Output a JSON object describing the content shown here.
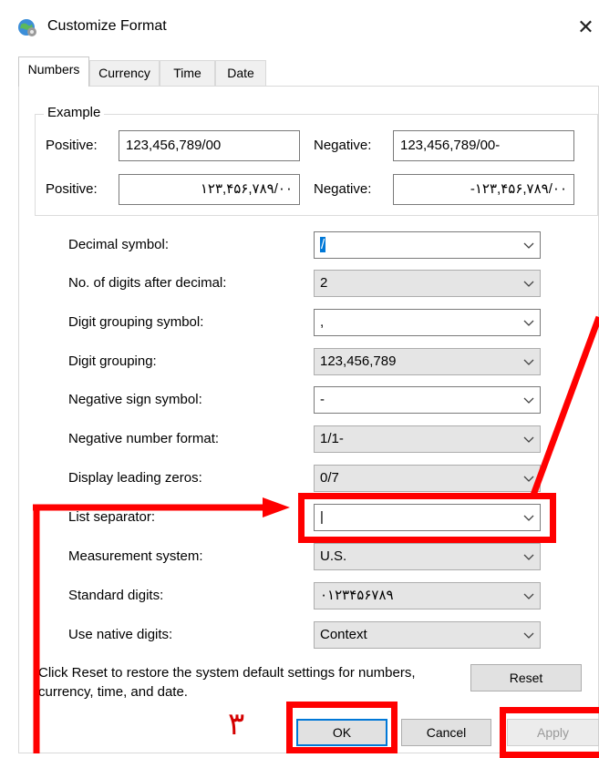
{
  "window": {
    "title": "Customize Format",
    "close_glyph": "✕",
    "icon": "globe-settings-icon"
  },
  "tabs": [
    {
      "label": "Numbers",
      "active": true
    },
    {
      "label": "Currency",
      "active": false
    },
    {
      "label": "Time",
      "active": false
    },
    {
      "label": "Date",
      "active": false
    }
  ],
  "example": {
    "legend": "Example",
    "positive_label": "Positive:",
    "negative_label": "Negative:",
    "positive_latin": "123,456,789/00",
    "negative_latin": "123,456,789/00-",
    "positive_native": "۱۲۳,۴۵۶,۷۸۹/۰۰",
    "negative_native": "-۱۲۳,۴۵۶,۷۸۹/۰۰"
  },
  "settings": [
    {
      "label": "Decimal symbol:",
      "value": "/",
      "editable": true,
      "selected": true
    },
    {
      "label": "No. of digits after decimal:",
      "value": "2",
      "editable": false
    },
    {
      "label": "Digit grouping symbol:",
      "value": ",",
      "editable": true
    },
    {
      "label": "Digit grouping:",
      "value": "123,456,789",
      "editable": false
    },
    {
      "label": "Negative sign symbol:",
      "value": "-",
      "editable": true
    },
    {
      "label": "Negative number format:",
      "value": "1/1-",
      "editable": false
    },
    {
      "label": "Display leading zeros:",
      "value": "0/7",
      "editable": false
    },
    {
      "label": "List separator:",
      "value": "|",
      "editable": true
    },
    {
      "label": "Measurement system:",
      "value": "U.S.",
      "editable": false
    },
    {
      "label": "Standard digits:",
      "value": "۰۱۲۳۴۵۶۷۸۹",
      "editable": false
    },
    {
      "label": "Use native digits:",
      "value": "Context",
      "editable": false
    }
  ],
  "footer": {
    "reset_note": "Click Reset to restore the system default settings for numbers, currency, time, and date.",
    "reset_label": "Reset",
    "ok_label": "OK",
    "cancel_label": "Cancel",
    "apply_label": "Apply"
  },
  "annotation": {
    "step_number": "۳",
    "color": "#ff0000"
  }
}
